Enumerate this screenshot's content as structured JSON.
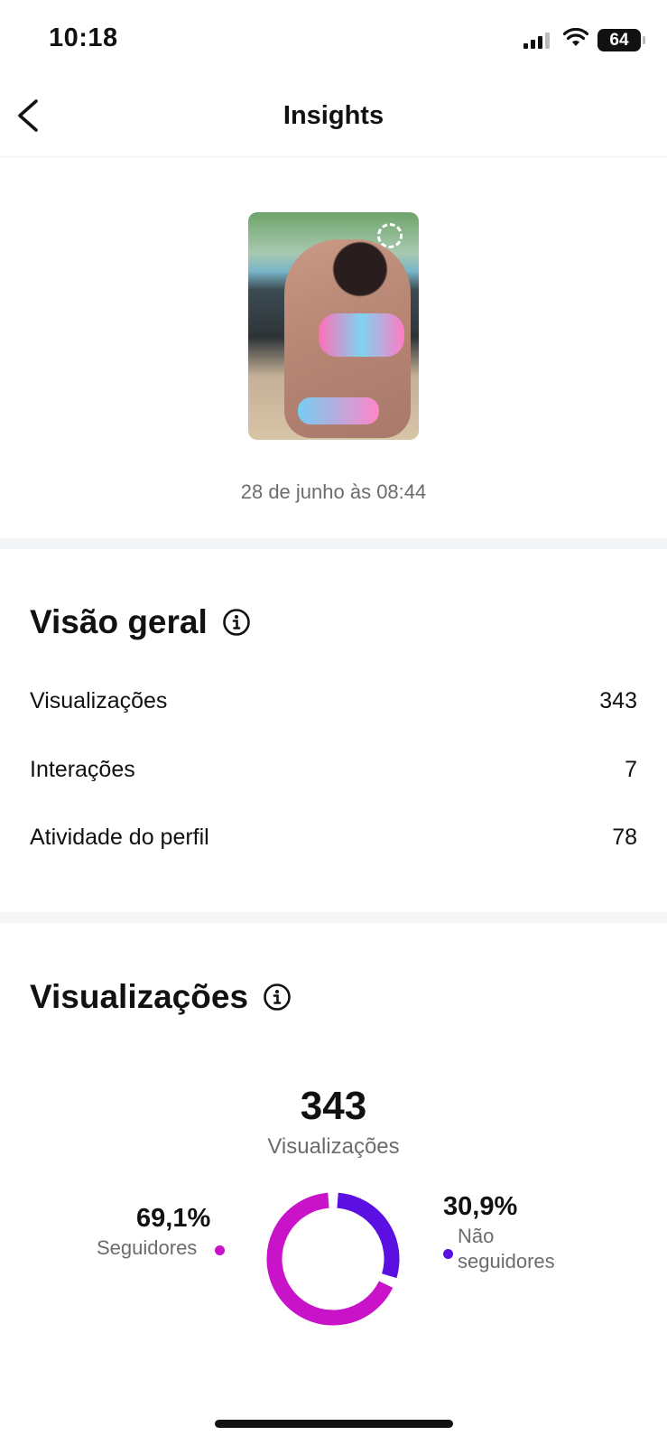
{
  "status_bar": {
    "time": "10:18",
    "battery": "64"
  },
  "header": {
    "title": "Insights"
  },
  "post": {
    "date": "28 de junho às 08:44"
  },
  "overview": {
    "title": "Visão geral",
    "metrics": [
      {
        "label": "Visualizações",
        "value": "343"
      },
      {
        "label": "Interações",
        "value": "7"
      },
      {
        "label": "Atividade do perfil",
        "value": "78"
      }
    ]
  },
  "views": {
    "title": "Visualizações",
    "total": "343",
    "total_label": "Visualizações",
    "followers": {
      "percent": "69,1%",
      "label": "Seguidores",
      "fraction": 0.691,
      "color": "#c913c8"
    },
    "non_followers": {
      "percent": "30,9%",
      "label_line1": "Não",
      "label_line2": "seguidores",
      "fraction": 0.309,
      "color": "#5b0fe0"
    }
  },
  "icons": {
    "back": "chevron-left-icon",
    "info": "info-circle-icon",
    "signal": "cellular-signal-icon",
    "wifi": "wifi-icon",
    "battery": "battery-icon"
  }
}
